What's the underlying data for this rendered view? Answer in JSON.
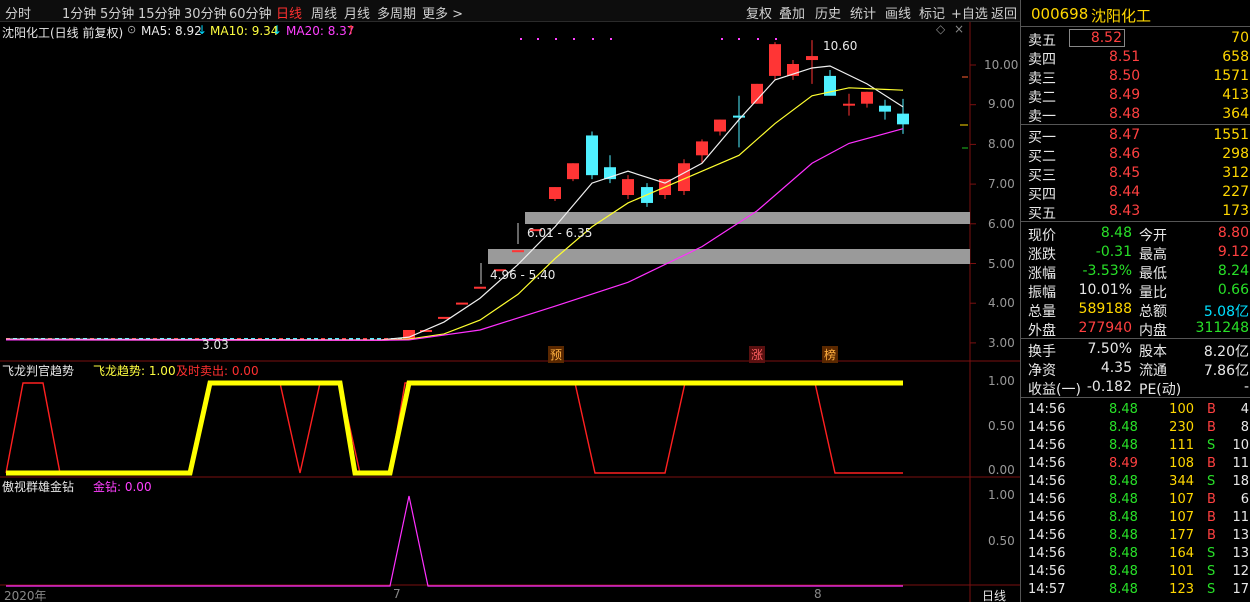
{
  "toolbar": {
    "periods": [
      "分时",
      "1分钟",
      "5分钟",
      "15分钟",
      "30分钟",
      "60分钟",
      "日线",
      "周线",
      "月线",
      "多周期",
      "更多 >"
    ],
    "actions": [
      "复权",
      "叠加",
      "历史",
      "统计",
      "画线",
      "标记",
      "+自选",
      "返回"
    ]
  },
  "chart": {
    "title": "沈阳化工(日线 前复权)",
    "ma5_label": "MA5: 8.92",
    "ma10_label": "MA10: 9.34",
    "ma20_label": "MA20: 8.37",
    "high_label": "10.60",
    "low_label": "3.03",
    "zone1_label": "6.01 - 6.35",
    "zone2_label": "4.96 - 5.40",
    "price_ticks": [
      "10.00",
      "9.00",
      "8.00",
      "7.00",
      "6.00",
      "5.00",
      "4.00",
      "3.00"
    ],
    "markers": [
      "预",
      "涨",
      "榜"
    ],
    "date_labels": [
      "2020年",
      "7",
      "8"
    ],
    "x_axis_unit": "日线"
  },
  "indicator1": {
    "name": "飞龙判官趋势",
    "trend_label": "飞龙趋势: 1.00",
    "sell_label": "及时卖出: 0.00",
    "ticks": [
      "1.00",
      "0.50",
      "0.00"
    ]
  },
  "indicator2": {
    "name": "傲视群雄金钻",
    "gold_label": "金钻: 0.00",
    "ticks": [
      "1.00",
      "0.50"
    ]
  },
  "stock": {
    "code": "000698",
    "name": "沈阳化工"
  },
  "asks": [
    {
      "label": "卖五",
      "price": "8.52",
      "vol": "70"
    },
    {
      "label": "卖四",
      "price": "8.51",
      "vol": "658"
    },
    {
      "label": "卖三",
      "price": "8.50",
      "vol": "1571"
    },
    {
      "label": "卖二",
      "price": "8.49",
      "vol": "413"
    },
    {
      "label": "卖一",
      "price": "8.48",
      "vol": "364"
    }
  ],
  "bids": [
    {
      "label": "买一",
      "price": "8.47",
      "vol": "1551"
    },
    {
      "label": "买二",
      "price": "8.46",
      "vol": "298"
    },
    {
      "label": "买三",
      "price": "8.45",
      "vol": "312"
    },
    {
      "label": "买四",
      "price": "8.44",
      "vol": "227"
    },
    {
      "label": "买五",
      "price": "8.43",
      "vol": "173"
    }
  ],
  "quote": [
    {
      "l1": "现价",
      "v1": "8.48",
      "c1": "green",
      "l2": "今开",
      "v2": "8.80",
      "c2": "red"
    },
    {
      "l1": "涨跌",
      "v1": "-0.31",
      "c1": "green",
      "l2": "最高",
      "v2": "9.12",
      "c2": "red"
    },
    {
      "l1": "涨幅",
      "v1": "-3.53%",
      "c1": "green",
      "l2": "最低",
      "v2": "8.24",
      "c2": "green"
    },
    {
      "l1": "振幅",
      "v1": "10.01%",
      "c1": "white",
      "l2": "量比",
      "v2": "0.66",
      "c2": "green"
    },
    {
      "l1": "总量",
      "v1": "589188",
      "c1": "yellow",
      "l2": "总额",
      "v2": "5.08亿",
      "c2": "cyan"
    },
    {
      "l1": "外盘",
      "v1": "277940",
      "c1": "red",
      "l2": "内盘",
      "v2": "311248",
      "c2": "green"
    }
  ],
  "finance": [
    {
      "l1": "换手",
      "v1": "7.50%",
      "l2": "股本",
      "v2": "8.20亿"
    },
    {
      "l1": "净资",
      "v1": "4.35",
      "l2": "流通",
      "v2": "7.86亿"
    },
    {
      "l1": "收益(一)",
      "v1": "-0.182",
      "l2": "PE(动)",
      "v2": "-"
    }
  ],
  "ticks": [
    {
      "t": "14:56",
      "p": "8.48",
      "v": "100",
      "bs": "B",
      "n": "4"
    },
    {
      "t": "14:56",
      "p": "8.48",
      "v": "230",
      "bs": "B",
      "n": "8"
    },
    {
      "t": "14:56",
      "p": "8.48",
      "v": "111",
      "bs": "S",
      "n": "10"
    },
    {
      "t": "14:56",
      "p": "8.49",
      "v": "108",
      "bs": "B",
      "n": "11"
    },
    {
      "t": "14:56",
      "p": "8.48",
      "v": "344",
      "bs": "S",
      "n": "18"
    },
    {
      "t": "14:56",
      "p": "8.48",
      "v": "107",
      "bs": "B",
      "n": "6"
    },
    {
      "t": "14:56",
      "p": "8.48",
      "v": "107",
      "bs": "B",
      "n": "11"
    },
    {
      "t": "14:56",
      "p": "8.48",
      "v": "177",
      "bs": "B",
      "n": "13"
    },
    {
      "t": "14:56",
      "p": "8.48",
      "v": "164",
      "bs": "S",
      "n": "13"
    },
    {
      "t": "14:56",
      "p": "8.48",
      "v": "101",
      "bs": "S",
      "n": "12"
    },
    {
      "t": "14:57",
      "p": "8.48",
      "v": "123",
      "bs": "S",
      "n": "17"
    }
  ]
}
